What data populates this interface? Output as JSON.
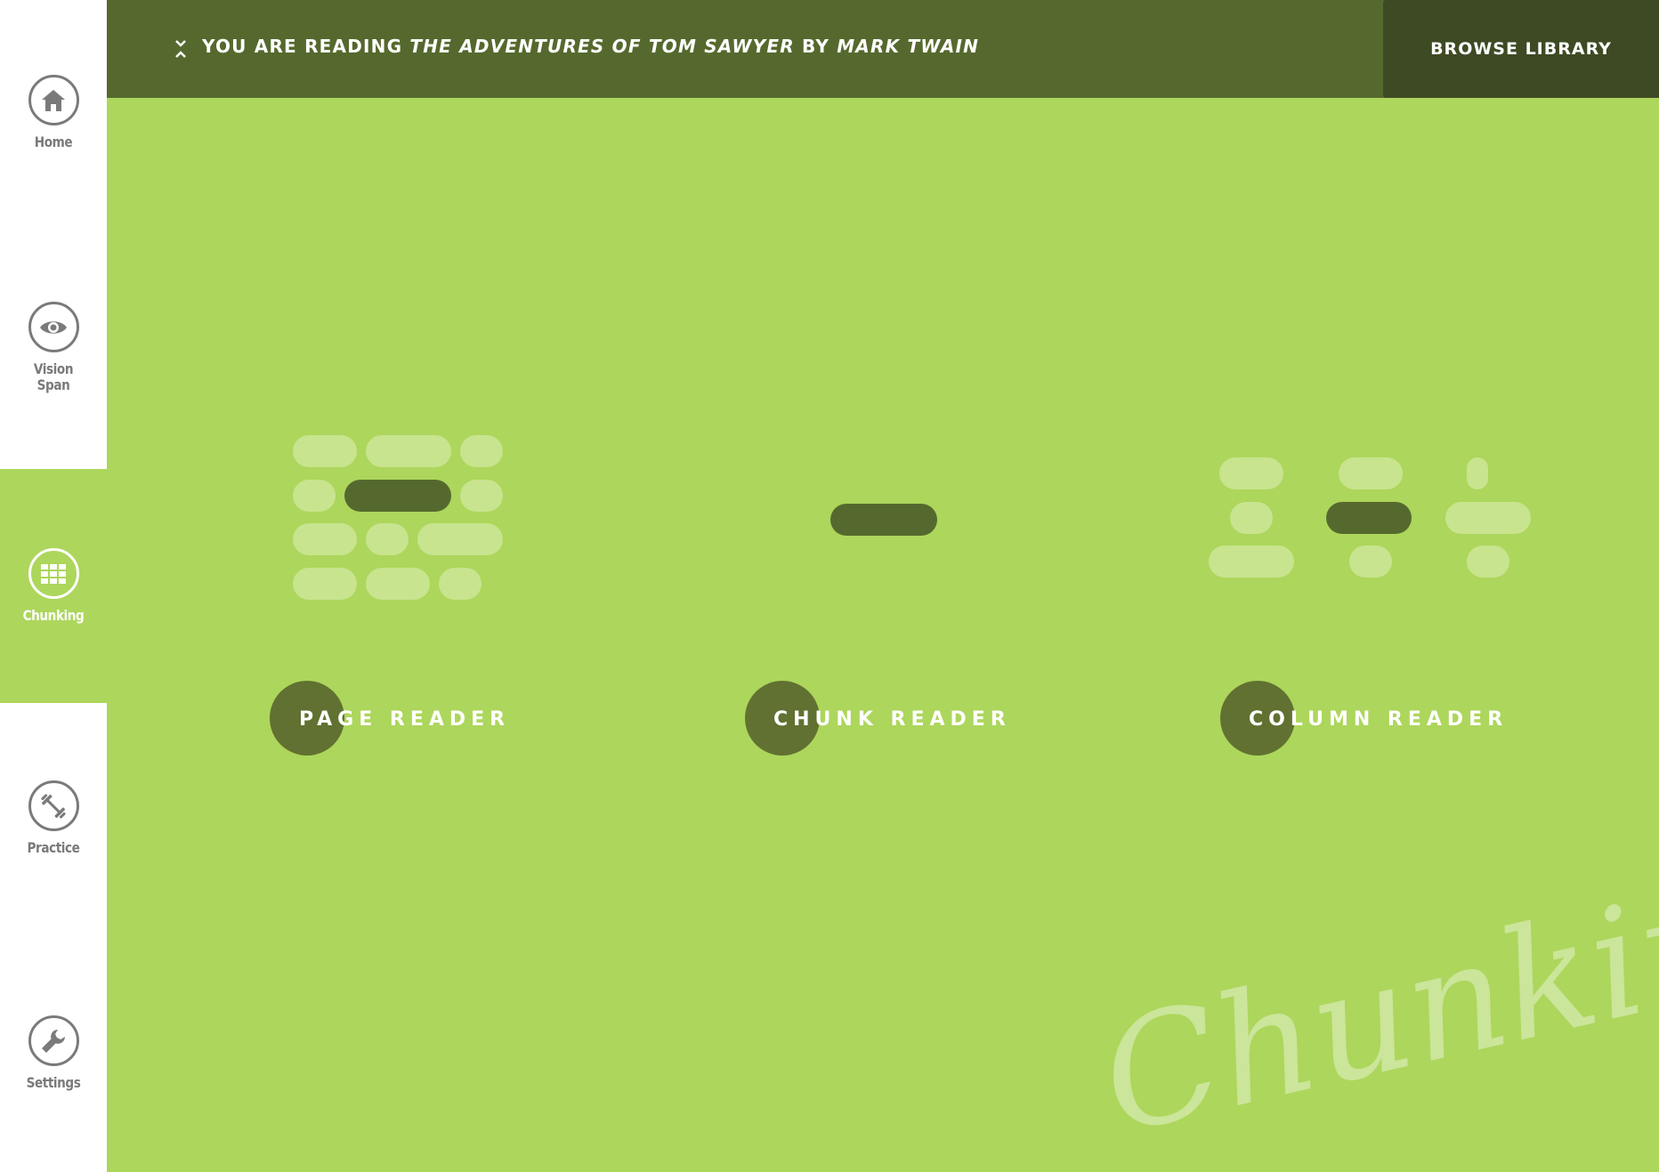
{
  "sidebar": {
    "items": [
      {
        "label": "Home",
        "icon": "home-icon",
        "active": false
      },
      {
        "label": "Vision Span",
        "icon": "eye-icon",
        "active": false
      },
      {
        "label": "Chunking",
        "icon": "grid-icon",
        "active": true
      },
      {
        "label": "Practice",
        "icon": "dumbbell-icon",
        "active": false
      },
      {
        "label": "Settings",
        "icon": "wrench-icon",
        "active": false
      }
    ]
  },
  "header": {
    "prefix": "YOU ARE READING",
    "book_title": "THE ADVENTURES OF TOM SAWYER",
    "by": "BY",
    "author": "MARK TWAIN",
    "browse_label": "BROWSE LIBRARY"
  },
  "modes": [
    {
      "label": "PAGE READER"
    },
    {
      "label": "CHUNK READER"
    },
    {
      "label": "COLUMN READER"
    }
  ],
  "watermark": "Chunking",
  "colors": {
    "background": "#add65c",
    "header": "#55692e",
    "browse_button": "#3e4a24",
    "pill_light": "#c8e48e",
    "pill_dark": "#55692e",
    "sidebar_icon": "#7a7a7a"
  }
}
